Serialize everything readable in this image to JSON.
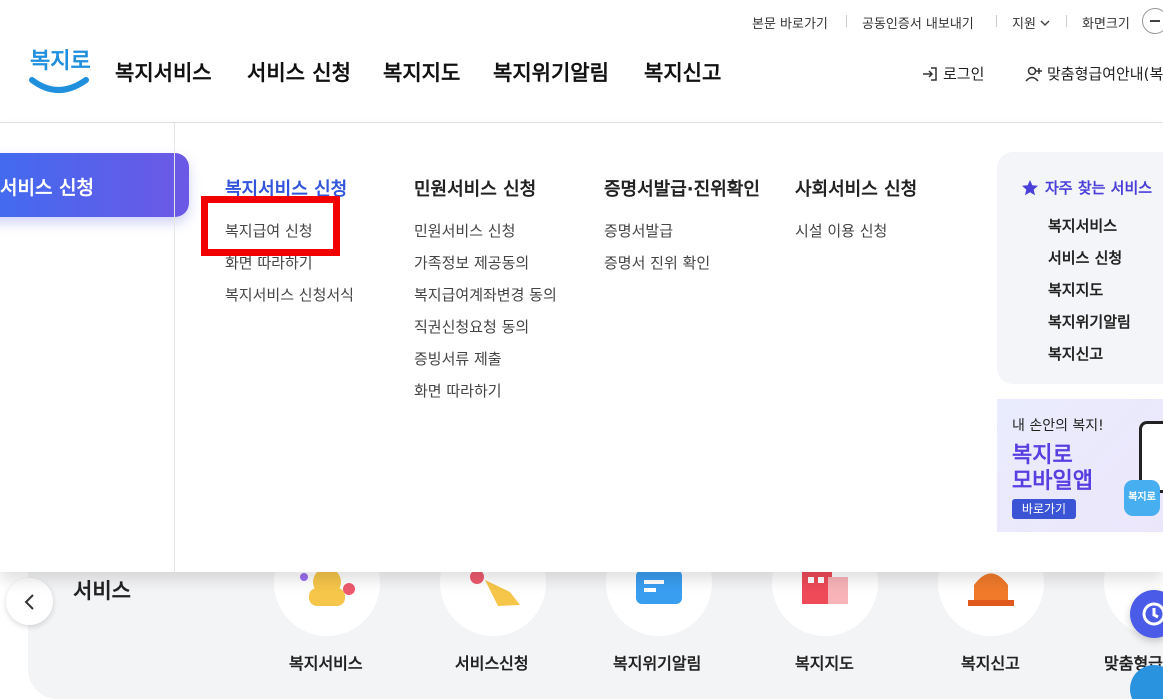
{
  "utility": {
    "skip_to_content": "본문 바로가기",
    "cert_export": "공동인증서 내보내기",
    "support": "지원",
    "zoom": "화면크기"
  },
  "brand": {
    "logo_text": "복지로"
  },
  "gnb": [
    "복지서비스",
    "서비스 신청",
    "복지지도",
    "복지위기알림",
    "복지신고"
  ],
  "header_links": {
    "login": "로그인",
    "custom_guide": "맞춤형급여안내(복"
  },
  "mega_menu": {
    "active_section": "서비스 신청",
    "columns": [
      {
        "title": "복지서비스 신청",
        "links": [
          "복지급여 신청",
          "화면 따라하기",
          "복지서비스 신청서식"
        ]
      },
      {
        "title": "민원서비스 신청",
        "links": [
          "민원서비스 신청",
          "가족정보 제공동의",
          "복지급여계좌변경 동의",
          "직권신청요청 동의",
          "증빙서류 제출",
          "화면 따라하기"
        ]
      },
      {
        "title": "증명서발급·진위확인",
        "links": [
          "증명서발급",
          "증명서 진위 확인"
        ]
      },
      {
        "title": "사회서비스 신청",
        "links": [
          "시설 이용 신청"
        ]
      }
    ]
  },
  "favorites": {
    "title": "자주 찾는 서비스",
    "items": [
      "복지서비스",
      "서비스 신청",
      "복지지도",
      "복지위기알림",
      "복지신고"
    ]
  },
  "banner": {
    "subtitle": "내 손안의 복지!",
    "title_line1": "복지로",
    "title_line2": "모바일앱",
    "button": "바로가기",
    "app_icon": "복지로"
  },
  "background_section": {
    "heading": "서비스",
    "items": [
      "복지서비스",
      "서비스신청",
      "복지위기알림",
      "복지지도",
      "복지신고",
      "맞춤형급"
    ]
  },
  "colors": {
    "accent": "#3355d9",
    "highlight": "#f20000",
    "pill_start": "#3e6cf0",
    "pill_end": "#6d58e6"
  },
  "icons": [
    "login-icon",
    "user-add-icon",
    "star-icon",
    "chevron-down-icon",
    "chevron-left-icon",
    "minus-icon"
  ]
}
